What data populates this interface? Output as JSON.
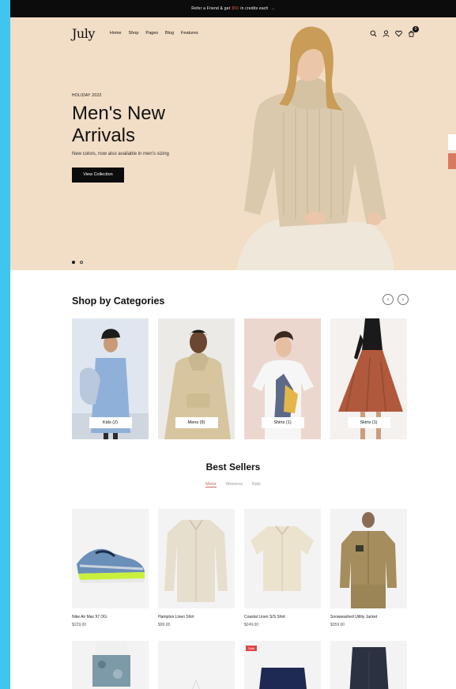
{
  "announcement": {
    "before": "Refer a Friend & get",
    "accent": "$50",
    "after": "in credits each",
    "arrow": "→"
  },
  "header": {
    "logo": "July",
    "menu": [
      "Home",
      "Shop",
      "Pages",
      "Blog",
      "Features"
    ],
    "cart_count": "0",
    "icons": [
      "search-icon",
      "account-icon",
      "wishlist-icon",
      "cart-icon"
    ]
  },
  "hero": {
    "eyebrow": "HOLIDAY 2022",
    "headline": "Men's New Arrivals",
    "subline": "New colors, now also available in men's sizing",
    "cta": "View Collection",
    "slides": 2,
    "active_slide": 1
  },
  "categories": {
    "title": "Shop by Categories",
    "prev_icon": "‹",
    "next_icon": "›",
    "items": [
      {
        "label": "Kids (2)"
      },
      {
        "label": "Mens (9)"
      },
      {
        "label": "Shirts (1)"
      },
      {
        "label": "Skirts (1)"
      }
    ]
  },
  "best_sellers": {
    "title": "Best Sellers",
    "tabs": [
      "Mens",
      "Womens",
      "Kids"
    ],
    "active_tab": "Mens",
    "products": [
      {
        "name": "Nike Air Max 97 OG",
        "price": "$229.00"
      },
      {
        "name": "Hampton Linen Shirt",
        "price": "$99.00"
      },
      {
        "name": "Coastal Linen S/S Shirt",
        "price": "$249.00"
      },
      {
        "name": "Snowwashed Utility Jacket",
        "price": "$359.00"
      }
    ],
    "row2_badge": "Sale"
  },
  "colors": {
    "hero_bg": "#f2ddc6",
    "accent": "#d0655a",
    "dark": "#0c0c0c",
    "frame": "#3fc6ee"
  }
}
